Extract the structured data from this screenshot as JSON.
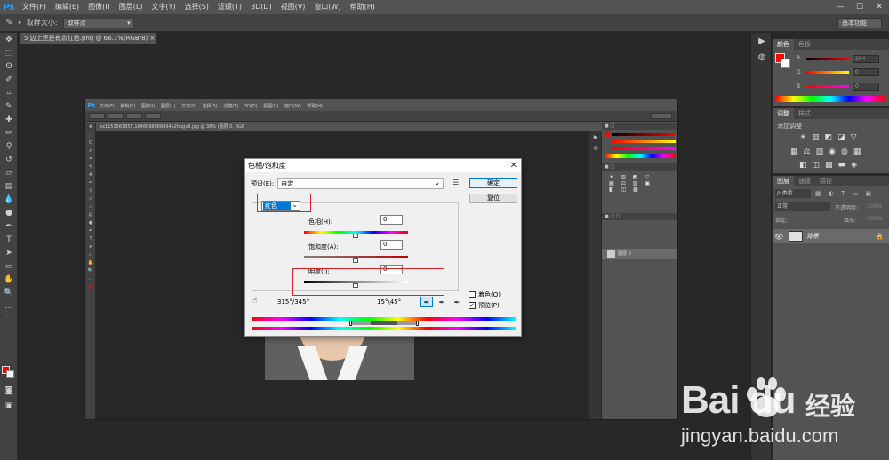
{
  "app": {
    "logo": "Ps",
    "menu": [
      "文件(F)",
      "编辑(E)",
      "图像(I)",
      "图层(L)",
      "文字(Y)",
      "选择(S)",
      "滤镜(T)",
      "3D(D)",
      "视图(V)",
      "窗口(W)",
      "帮助(H)"
    ],
    "window_controls": [
      "—",
      "☐",
      "✕"
    ]
  },
  "options_bar": {
    "sample_size_label": "取样大小:",
    "sample_size_value": "取样点",
    "workspace": "基本功能"
  },
  "document": {
    "tab_title": "5 边上还是有点红色.png @ 66.7%(RGB/8)"
  },
  "nested_screenshot": {
    "logo": "Ps",
    "menu": [
      "文件(F)",
      "编辑(E)",
      "图像(I)",
      "图层(L)",
      "文字(Y)",
      "选择(S)",
      "滤镜(T)",
      "3D(D)",
      "视图(V)",
      "窗口(W)",
      "帮助(H)"
    ],
    "tab_title": "xx1151561855.1648098888494x2hbgv6.jpg @ 38% (图层 0, RGB/8)",
    "layer_name": "图层 0",
    "workspace": "基本功能"
  },
  "dialog": {
    "title": "色相/饱和度",
    "close": "✕",
    "preset_label": "预设(E):",
    "preset_value": "自定",
    "ok_label": "确定",
    "reset_label": "复位",
    "channel_value": "红色",
    "hue_label": "色相(H):",
    "hue_value": "0",
    "saturation_label": "饱和度(A):",
    "saturation_value": "0",
    "lightness_label": "明度(I):",
    "lightness_value": "0",
    "range_left": "315°/345°",
    "range_right": "15°\\45°",
    "colorize_label": "着色(O)",
    "colorize_checked": false,
    "preview_label": "预览(P)",
    "preview_checked": true
  },
  "color_panel": {
    "tabs": [
      "颜色",
      "色板"
    ],
    "r_label": "R",
    "r_value": "204",
    "g_label": "G",
    "g_value": "0",
    "b_label": "B",
    "b_value": "0",
    "fg_color": "#ff0000"
  },
  "adjust_panel": {
    "tabs": [
      "调整",
      "样式"
    ],
    "title": "添加调整"
  },
  "layers_panel": {
    "tabs": [
      "图层",
      "通道",
      "路径"
    ],
    "filter_label": "ρ 类型",
    "blend_mode": "正常",
    "opacity_label": "不透明度:",
    "opacity_value": "100%",
    "lock_label": "锁定:",
    "fill_label": "填充:",
    "fill_value": "100%",
    "layer_name": "背景"
  },
  "watermark": {
    "logo": "Bai du",
    "text": "经验",
    "url": "jingyan.baidu.com"
  }
}
